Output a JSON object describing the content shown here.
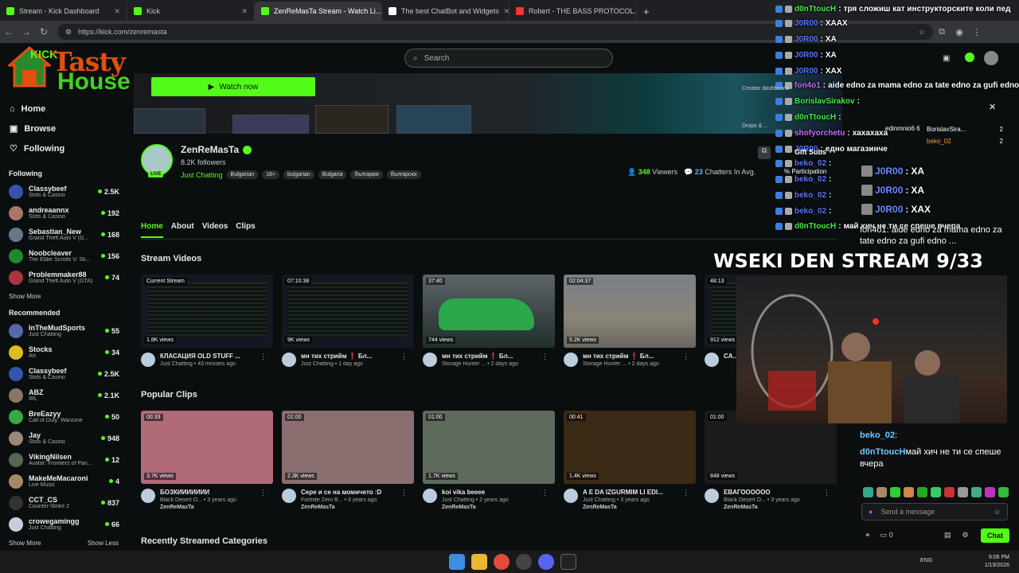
{
  "browser": {
    "tabs": [
      {
        "label": "Stream - Kick Dashboard",
        "color": "#53fc18"
      },
      {
        "label": "Kick",
        "color": "#53fc18"
      },
      {
        "label": "ZenReMasTa Stream - Watch Li...",
        "color": "#53fc18",
        "active": true
      },
      {
        "label": "The best ChatBot and Widgets",
        "color": "#ffffff"
      },
      {
        "label": "Robert - THE BASS PROTOCOL...",
        "color": "#ff3333"
      }
    ],
    "url": "https://kick.com/zenremasta"
  },
  "logo": {
    "line1": "Tasty",
    "line2": "House",
    "kick": "KICK"
  },
  "search": {
    "placeholder": "Search"
  },
  "sidebar": {
    "nav": [
      {
        "label": "Home",
        "icon": "home-icon"
      },
      {
        "label": "Browse",
        "icon": "browse-icon"
      },
      {
        "label": "Following",
        "icon": "heart-icon"
      }
    ],
    "following_title": "Following",
    "following": [
      {
        "name": "Classybeef",
        "cat": "Slots & Casino",
        "viewers": "2.5K",
        "color": "#3355aa"
      },
      {
        "name": "andreaannx",
        "cat": "Slots & Casino",
        "viewers": "192",
        "color": "#aa7766"
      },
      {
        "name": "Sebastian_New",
        "cat": "Grand Theft Auto V (G...",
        "viewers": "168",
        "color": "#667788"
      },
      {
        "name": "Noobcleaver",
        "cat": "The Elder Scrolls V: Sk...",
        "viewers": "156",
        "color": "#1a8a2a"
      },
      {
        "name": "Problemmaker88",
        "cat": "Grand Theft Auto V (GTA)",
        "viewers": "74",
        "color": "#aa3344"
      }
    ],
    "show_more": "Show More",
    "recommended_title": "Recommended",
    "recommended": [
      {
        "name": "InTheMudSports",
        "cat": "Just Chatting",
        "viewers": "55",
        "color": "#5566aa"
      },
      {
        "name": "Stocks",
        "cat": "Art",
        "viewers": "34",
        "color": "#ddbb22"
      },
      {
        "name": "Classybeef",
        "cat": "Slots & Casino",
        "viewers": "2.5K",
        "color": "#3355aa"
      },
      {
        "name": "ABZ",
        "cat": "IRL",
        "viewers": "2.1K",
        "color": "#887766"
      },
      {
        "name": "BreEazyy",
        "cat": "Call of Duty: Warzone",
        "viewers": "50",
        "color": "#33aa44"
      },
      {
        "name": "Jay",
        "cat": "Slots & Casino",
        "viewers": "948",
        "color": "#998877"
      },
      {
        "name": "VikingNilsen",
        "cat": "Avatar: Frontiers of Pan...",
        "viewers": "12",
        "color": "#556655"
      },
      {
        "name": "MakeMeMacaroni",
        "cat": "Live Music",
        "viewers": "4",
        "color": "#aa8866"
      },
      {
        "name": "CCT_CS",
        "cat": "Counter-Strike 2",
        "viewers": "837",
        "color": "#333333"
      },
      {
        "name": "crowegamingg",
        "cat": "Just Chatting",
        "viewers": "66",
        "color": "#ccccdd"
      }
    ],
    "show_more2": "Show More",
    "show_less": "Show Less"
  },
  "channel": {
    "watch_now": "Watch now",
    "name": "ZenReMasTa",
    "followers": "8.2K followers",
    "live": "LIVE",
    "category": "Just Chatting",
    "tags": [
      "Bulgarian",
      "18+",
      "bulgarian",
      "Bulgaria",
      "българия",
      "български"
    ],
    "viewers_num": "348",
    "viewers_label": "Viewers",
    "chatters_num": "23",
    "chatters_label": "Chatters In Avg."
  },
  "tabs": [
    "Home",
    "About",
    "Videos",
    "Clips"
  ],
  "stream_videos_title": "Stream Videos",
  "videos": [
    {
      "badge": "Current Stream",
      "views": "1.8K views",
      "title": "КЛАСАЦИЯ OLD STUFF ...",
      "sub": "Just Chatting • 43 minutes ago",
      "bg": "scr"
    },
    {
      "badge": "07:10:38",
      "views": "9K views",
      "title": "мн тих стрийм ❗ Бл...",
      "sub": "Just Chatting • 1 day ago",
      "bg": "scr"
    },
    {
      "badge": "37:40",
      "views": "744 views",
      "title": "мн тих стрийм ❗ Бл...",
      "sub": "Storage Hunter ... • 2 days ago",
      "bg": "car"
    },
    {
      "badge": "02:04:37",
      "views": "5.2K views",
      "title": "мн тих стрийм ❗ Бл...",
      "sub": "Storage Hunter ... • 2 days ago",
      "bg": "gta"
    },
    {
      "badge": "48:13",
      "views": "912 views",
      "title": "CA...",
      "sub": "",
      "bg": "scr"
    }
  ],
  "popular_clips_title": "Popular Clips",
  "clips": [
    {
      "badge": "00:33",
      "views": "3.7K views",
      "title": "БОЗКИИИИИИИ",
      "sub": "Black Desert O... • 3 years ago",
      "author": "ZenReMasTa",
      "bg": "#b06a78"
    },
    {
      "badge": "01:00",
      "views": "2.3K views",
      "title": "Сере и се на момичето :D",
      "sub": "Fortnite Zero B... • 3 years ago",
      "author": "ZenReMasTa",
      "bg": "#8a6e70"
    },
    {
      "badge": "01:00",
      "views": "1.7K views",
      "title": "koi vika beeee",
      "sub": "Just Chatting • 2 years ago",
      "author": "ZenReMasTa",
      "bg": "#5e6a5c"
    },
    {
      "badge": "00:41",
      "views": "1.4K views",
      "title": "A E DA IZGURMIM LI EDI...",
      "sub": "Just Chatting • 3 years ago",
      "author": "ZenReMasTa",
      "bg": "#3a2a16"
    },
    {
      "badge": "01:00",
      "views": "848 views",
      "title": "EBAГОООООО",
      "sub": "Black Desert O... • 3 years ago",
      "author": "ZenReMasTa",
      "bg": "#1c1a1c"
    }
  ],
  "recent_categories_title": "Recently Streamed Categories",
  "overlay": {
    "chat": [
      {
        "user": "d0nTtoucH",
        "color": "#44ee44",
        "msg": "тря сложиш кат инструкторските коли пед"
      },
      {
        "user": "J0R00",
        "color": "#5577ff",
        "msg": "XAAX"
      },
      {
        "user": "J0R00",
        "color": "#5577ff",
        "msg": "XA"
      },
      {
        "user": "J0R00",
        "color": "#5577ff",
        "msg": "XA"
      },
      {
        "user": "J0R00",
        "color": "#5577ff",
        "msg": "XAX"
      },
      {
        "user": "fon4o1",
        "color": "#cc66ff",
        "msg": "aide edno za mama edno za tate edno za gufi edno"
      },
      {
        "user": "BorislavSirakov",
        "color": "#44ee44",
        "msg": ""
      },
      {
        "user": "d0nTtoucH",
        "color": "#44ee44",
        "msg": ""
      },
      {
        "user": "shofyorchetu",
        "color": "#cc66ff",
        "msg": "хахахаха"
      },
      {
        "user": "J0R00",
        "color": "#5577ff",
        "msg": "едно магазинче"
      },
      {
        "user": "beko_02",
        "color": "#5577ff",
        "msg": ""
      },
      {
        "user": "beko_02",
        "color": "#5577ff",
        "msg": ""
      },
      {
        "user": "beko_02",
        "color": "#5577ff",
        "msg": ""
      },
      {
        "user": "beko_02",
        "color": "#5577ff",
        "msg": ""
      },
      {
        "user": "d0nTtoucH",
        "color": "#44ee44",
        "msg": "май хич не ти се спеше вчера"
      }
    ],
    "stream_title": "WSEKI DEN STREAM 9/33",
    "gift_subs": "Gift Subs",
    "participation": "% Participation",
    "creator_dashboard": "Creator dashboard",
    "drops": "Drops & ...",
    "leaderboard": [
      {
        "name": "BorislavSira...",
        "n": "2"
      },
      {
        "name": "beko_02",
        "n": "2"
      }
    ],
    "lb_left": "edinmnio6",
    "lb_left_n": "6",
    "chatpanel": [
      {
        "user": "J0R00",
        "msg": "XA"
      },
      {
        "user": "J0R00",
        "msg": "XA"
      },
      {
        "user": "J0R00",
        "msg": "XAX"
      }
    ],
    "panel_bottom": [
      {
        "user": "beko_02",
        "msg": ":"
      },
      {
        "user": "d0nTtoucH",
        "msg": "май хич не ти се спеше вчера"
      }
    ],
    "fon_msg": "fon4o1: aide edno za mama edno za tate edno za gufi edno ...",
    "send_placeholder": "Send a message",
    "chat_button": "Chat",
    "points": "0"
  },
  "taskbar": {
    "lang": "ENG",
    "time": "9:06 PM",
    "date": "1/19/2026"
  }
}
